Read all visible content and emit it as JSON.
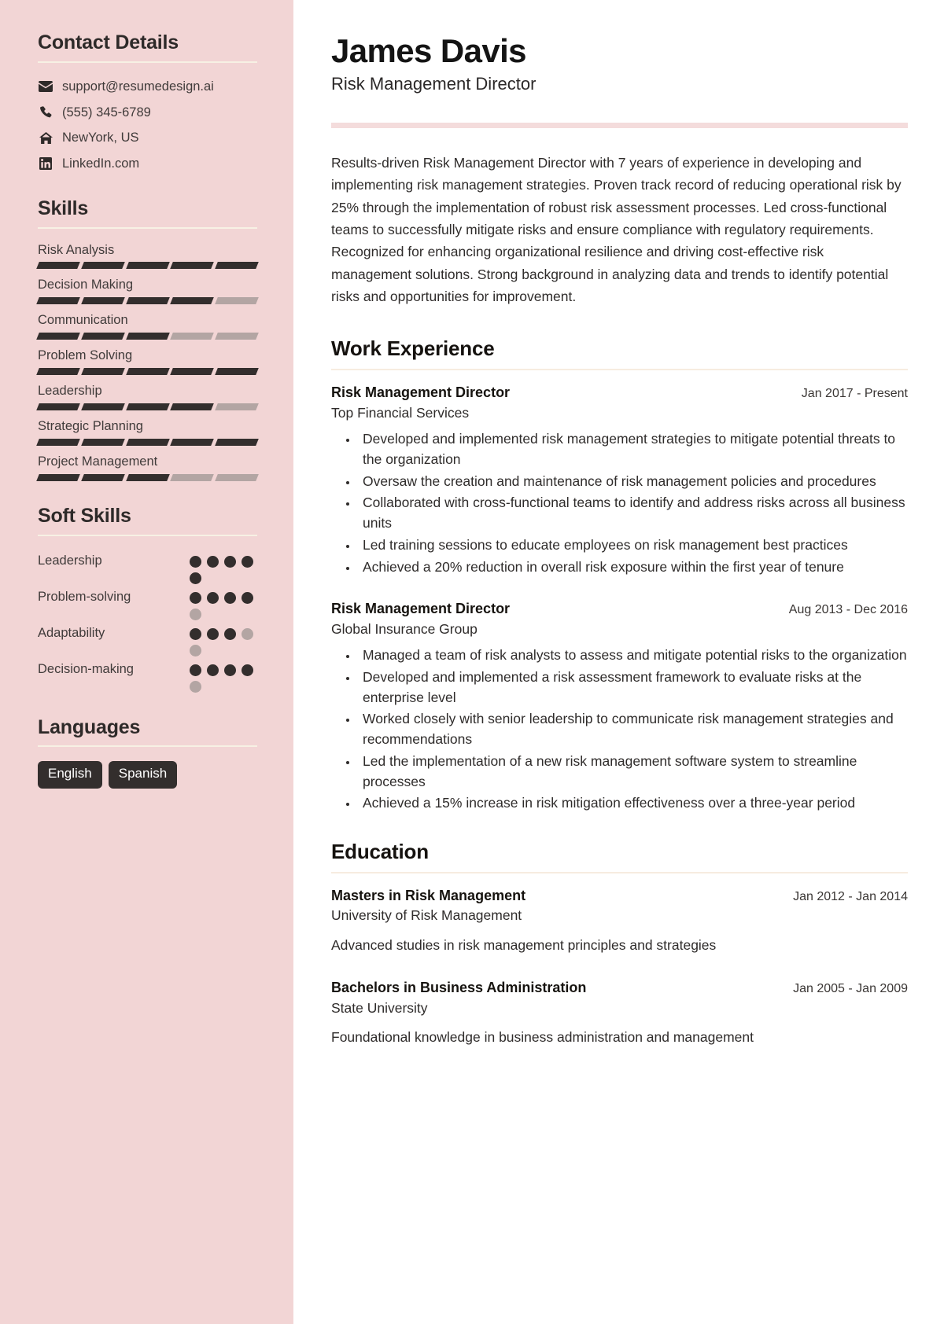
{
  "theme": {
    "sidebar_bg": "#f2d5d5",
    "accent_bar": "#f4dcdc",
    "dark": "#332e2d",
    "muted": "#b3a5a3",
    "rule_sidebar": "#f7f1e4",
    "rule_main": "#f7ece0"
  },
  "sidebar": {
    "contact": {
      "heading": "Contact Details",
      "items": [
        {
          "icon": "envelope-icon",
          "text": "support@resumedesign.ai"
        },
        {
          "icon": "phone-icon",
          "text": "(555) 345-6789"
        },
        {
          "icon": "home-icon",
          "text": "NewYork, US"
        },
        {
          "icon": "linkedin-icon",
          "text": "LinkedIn.com"
        }
      ]
    },
    "skills": {
      "heading": "Skills",
      "max": 5,
      "items": [
        {
          "label": "Risk Analysis",
          "level": 5
        },
        {
          "label": "Decision Making",
          "level": 4
        },
        {
          "label": "Communication",
          "level": 3
        },
        {
          "label": "Problem Solving",
          "level": 5
        },
        {
          "label": "Leadership",
          "level": 4
        },
        {
          "label": "Strategic Planning",
          "level": 5
        },
        {
          "label": "Project Management",
          "level": 3
        }
      ]
    },
    "soft_skills": {
      "heading": "Soft Skills",
      "max": 5,
      "items": [
        {
          "label": "Leadership",
          "level": 5
        },
        {
          "label": "Problem-solving",
          "level": 4
        },
        {
          "label": "Adaptability",
          "level": 3
        },
        {
          "label": "Decision-making",
          "level": 4
        }
      ]
    },
    "languages": {
      "heading": "Languages",
      "items": [
        "English",
        "Spanish"
      ]
    }
  },
  "header": {
    "name": "James Davis",
    "role": "Risk Management Director"
  },
  "summary": "Results-driven Risk Management Director with 7 years of experience in developing and implementing risk management strategies. Proven track record of reducing operational risk by 25% through the implementation of robust risk assessment processes. Led cross-functional teams to successfully mitigate risks and ensure compliance with regulatory requirements. Recognized for enhancing organizational resilience and driving cost-effective risk management solutions. Strong background in analyzing data and trends to identify potential risks and opportunities for improvement.",
  "work": {
    "heading": "Work Experience",
    "entries": [
      {
        "title": "Risk Management Director",
        "date": "Jan 2017 - Present",
        "org": "Top Financial Services",
        "bullets": [
          "Developed and implemented risk management strategies to mitigate potential threats to the organization",
          "Oversaw the creation and maintenance of risk management policies and procedures",
          "Collaborated with cross-functional teams to identify and address risks across all business units",
          "Led training sessions to educate employees on risk management best practices",
          "Achieved a 20% reduction in overall risk exposure within the first year of tenure"
        ]
      },
      {
        "title": "Risk Management Director",
        "date": "Aug 2013 - Dec 2016",
        "org": "Global Insurance Group",
        "bullets": [
          "Managed a team of risk analysts to assess and mitigate potential risks to the organization",
          "Developed and implemented a risk assessment framework to evaluate risks at the enterprise level",
          "Worked closely with senior leadership to communicate risk management strategies and recommendations",
          "Led the implementation of a new risk management software system to streamline processes",
          "Achieved a 15% increase in risk mitigation effectiveness over a three-year period"
        ]
      }
    ]
  },
  "education": {
    "heading": "Education",
    "entries": [
      {
        "title": "Masters in Risk Management",
        "date": "Jan 2012 - Jan 2014",
        "org": "University of Risk Management",
        "desc": "Advanced studies in risk management principles and strategies"
      },
      {
        "title": "Bachelors in Business Administration",
        "date": "Jan 2005 - Jan 2009",
        "org": "State University",
        "desc": "Foundational knowledge in business administration and management"
      }
    ]
  }
}
